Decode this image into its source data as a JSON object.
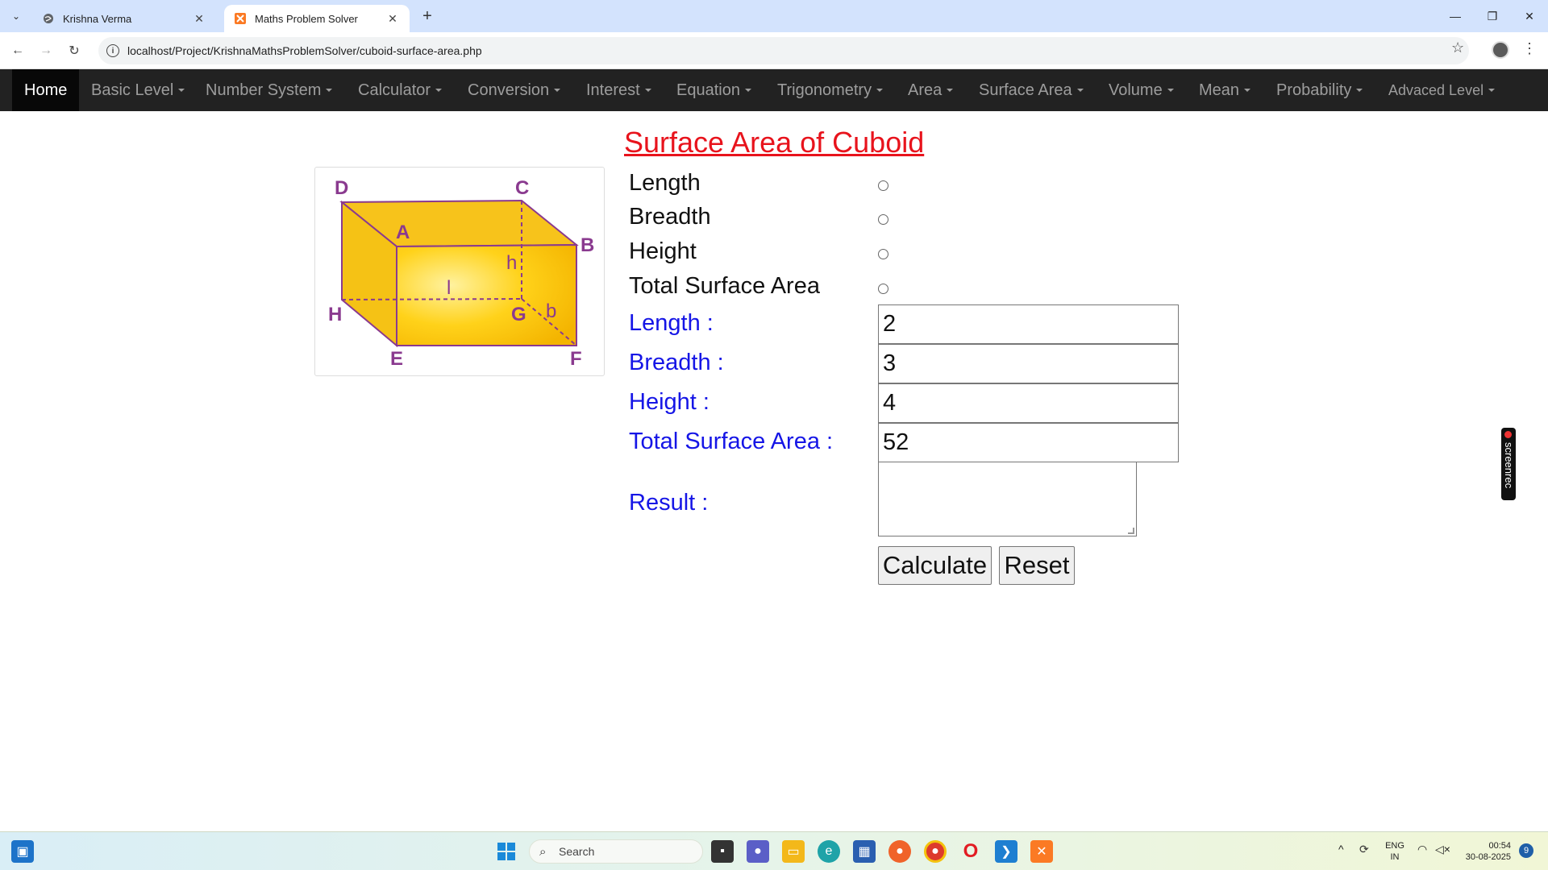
{
  "browser": {
    "tabs": [
      {
        "title": "Krishna Verma"
      },
      {
        "title": "Maths Problem Solver"
      }
    ],
    "url": "localhost/Project/KrishnaMathsProblemSolver/cuboid-surface-area.php"
  },
  "nav": {
    "home": "Home",
    "items": [
      "Basic Level",
      "Number System",
      "Calculator",
      "Conversion",
      "Interest",
      "Equation",
      "Trigonometry",
      "Area",
      "Surface Area",
      "Volume",
      "Mean",
      "Probability",
      "Advaced Level"
    ]
  },
  "page": {
    "title": "Surface Area of Cuboid",
    "figure_labels": {
      "D": "D",
      "C": "C",
      "A": "A",
      "B": "B",
      "H": "H",
      "G": "G",
      "E": "E",
      "F": "F",
      "l": "l",
      "h": "h",
      "b": "b"
    },
    "radio_options": [
      "Length",
      "Breadth",
      "Height",
      "Total Surface Area"
    ],
    "fields": {
      "length_label": "Length :",
      "length_value": "2",
      "breadth_label": "Breadth :",
      "breadth_value": "3",
      "height_label": "Height :",
      "height_value": "4",
      "tsa_label": "Total Surface Area :",
      "tsa_value": "52",
      "result_label": "Result :",
      "result_value": ""
    },
    "buttons": {
      "calculate": "Calculate",
      "reset": "Reset"
    }
  },
  "screenrec": "screenrec",
  "taskbar": {
    "search_placeholder": "Search",
    "lang_line1": "ENG",
    "lang_line2": "IN",
    "time": "00:54",
    "date": "30-08-2025",
    "notification_count": "9"
  },
  "colors": {
    "title": "#e8131c",
    "field_label": "#1515e6",
    "navbar_bg": "#222222",
    "cuboid_fill": "#ffd21a",
    "cuboid_edge": "#8a3a8f"
  }
}
